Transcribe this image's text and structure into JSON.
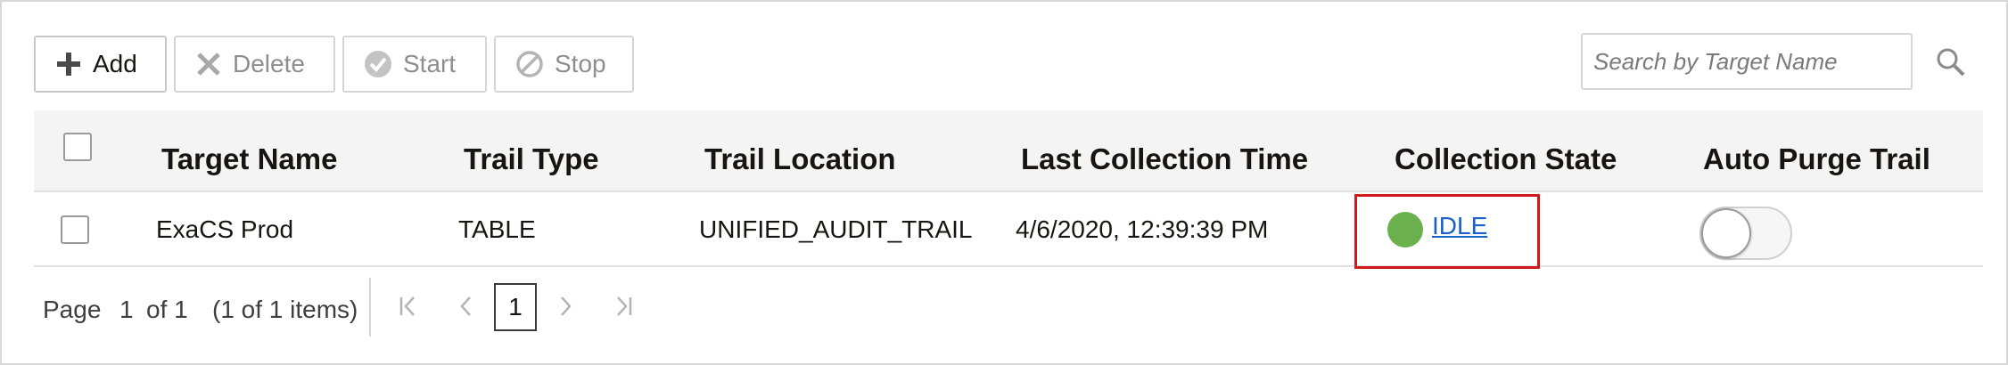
{
  "toolbar": {
    "add_label": "Add",
    "delete_label": "Delete",
    "start_label": "Start",
    "stop_label": "Stop"
  },
  "search": {
    "placeholder": "Search by Target Name",
    "value": ""
  },
  "table": {
    "columns": [
      "Target Name",
      "Trail Type",
      "Trail Location",
      "Last Collection Time",
      "Collection State",
      "Auto Purge Trail"
    ],
    "rows": [
      {
        "target_name": "ExaCS Prod",
        "trail_type": "TABLE",
        "trail_location": "UNIFIED_AUDIT_TRAIL",
        "last_collection_time": "4/6/2020, 12:39:39 PM",
        "collection_state": "IDLE",
        "auto_purge": false
      }
    ]
  },
  "pagination": {
    "page_label": "Page",
    "current_page": "1",
    "of_pages": "of 1",
    "items_summary": "(1 of 1 items)",
    "current_button": "1"
  },
  "colors": {
    "idle_status": "#6ab04c",
    "link": "#1a61c7",
    "highlight_box": "#d0191c",
    "header_bg": "#f4f4f4"
  },
  "icons": {
    "add": "plus-icon",
    "delete": "x-icon",
    "start": "check-circle-icon",
    "stop": "prohibited-icon",
    "search": "search-icon",
    "first": "first-page-icon",
    "prev": "chevron-left-icon",
    "next": "chevron-right-icon",
    "last": "last-page-icon"
  }
}
